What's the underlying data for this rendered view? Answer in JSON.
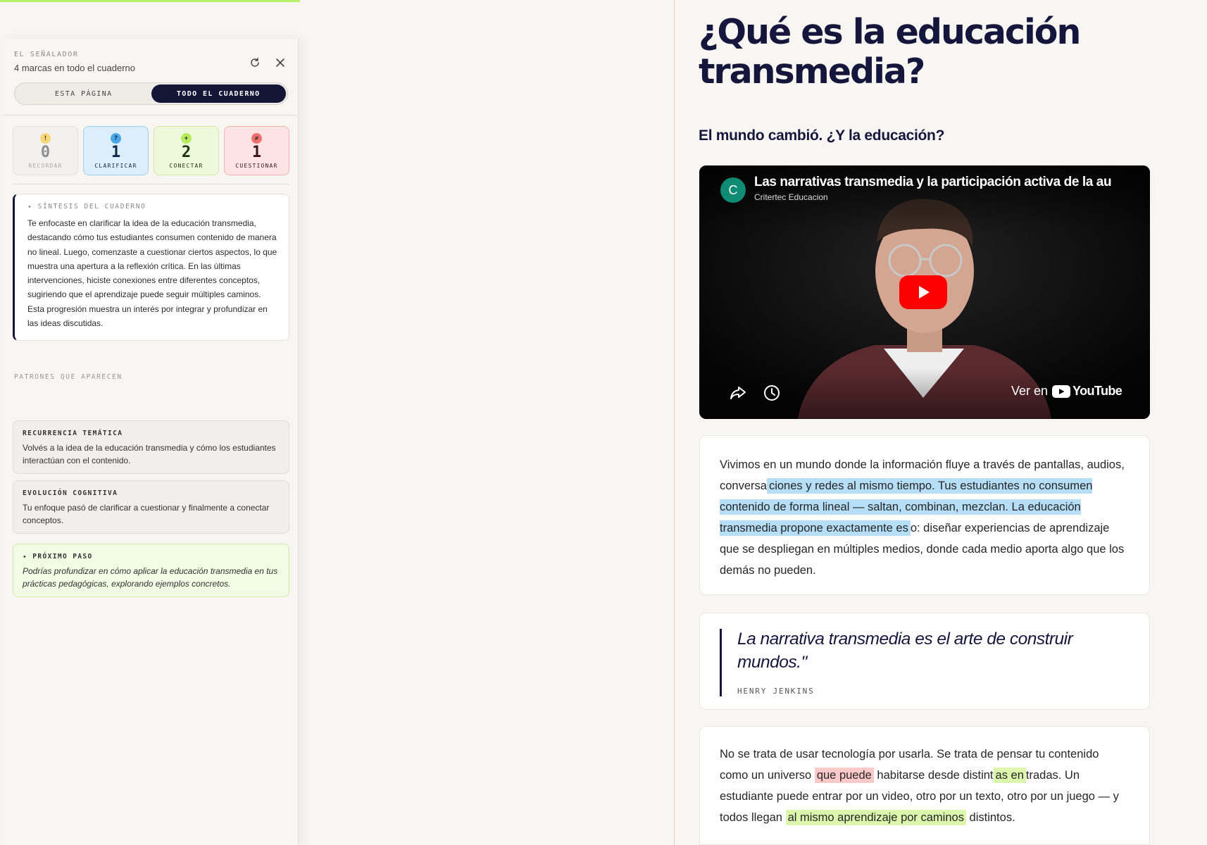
{
  "panel": {
    "eyebrow": "EL SEÑALADOR",
    "subtitle": "4 marcas en todo el cuaderno",
    "tabs": [
      {
        "label": "ESTA PÁGINA"
      },
      {
        "label": "TODO EL CUADERNO"
      }
    ],
    "stats": [
      {
        "symbol": "!",
        "count": "0",
        "label": "RECORDAR",
        "color": "#f7d77a"
      },
      {
        "symbol": "?",
        "count": "1",
        "label": "CLARIFICAR",
        "color": "#4aa7e8"
      },
      {
        "symbol": "+",
        "count": "2",
        "label": "CONECTAR",
        "color": "#b5ec5c"
      },
      {
        "symbol": "≠",
        "count": "1",
        "label": "CUESTIONAR",
        "color": "#f07070"
      }
    ],
    "synthesis": {
      "eyebrow": "✦ SÍNTESIS DEL CUADERNO",
      "text": "Te enfocaste en clarificar la idea de la educación transmedia, destacando cómo tus estudiantes consumen contenido de manera no lineal. Luego, comenzaste a cuestionar ciertos aspectos, lo que muestra una apertura a la reflexión crítica. En las últimas intervenciones, hiciste conexiones entre diferentes conceptos, sugiriendo que el aprendizaje puede seguir múltiples caminos. Esta progresión muestra un interés por integrar y profundizar en las ideas discutidas."
    },
    "patterns_title": "PATRONES QUE APARECEN",
    "patterns": [
      {
        "title": "RECURRENCIA TEMÁTICA",
        "text": "Volvés a la idea de la educación transmedia y cómo los estudiantes interactúan con el contenido."
      },
      {
        "title": "EVOLUCIÓN COGNITIVA",
        "text": "Tu enfoque pasó de clarificar a cuestionar y finalmente a conectar conceptos."
      }
    ],
    "next_step": {
      "title": "✦ PRÓXIMO PASO",
      "text": "Podrías profundizar en cómo aplicar la educación transmedia en tus prácticas pedagógicas, explorando ejemplos concretos."
    }
  },
  "article": {
    "title": "¿Qué es la educación transmedia?",
    "subtitle": "El mundo cambió. ¿Y la educación?",
    "video": {
      "title": "Las narrativas transmedia y la participación activa de la au",
      "channel": "Critertec Educacion",
      "channel_initial": "C",
      "watch_label": "Ver en",
      "platform": "YouTube"
    },
    "para1": {
      "pre": "Vivimos en un mundo donde la información fluye a través de pantallas, audios, conversa",
      "hl": "ciones y redes al mismo tiempo. Tus estudiantes no consumen contenido de forma lineal — saltan, combinan, mezclan. La educación transmedia propone exactamente es",
      "post": "o: diseñar experiencias de aprendizaje que se despliegan en múltiples medios, donde cada medio aporta algo que los demás no pueden."
    },
    "quote": {
      "text": "La narrativa transmedia es el arte de construir mundos.\"",
      "author": "HENRY JENKINS"
    },
    "para2": {
      "t1": "No se trata de usar tecnología por usarla. Se trata de pensar tu contenido como un universo ",
      "h1": "que puede",
      "t2": " habitarse desde distint",
      "h2": "as en",
      "t3": "tradas. Un estudiante puede entrar por un video, otro por un texto, otro por un juego — y todos llegan ",
      "h3": "al mismo aprendizaje por caminos",
      "t4": " distintos."
    }
  }
}
